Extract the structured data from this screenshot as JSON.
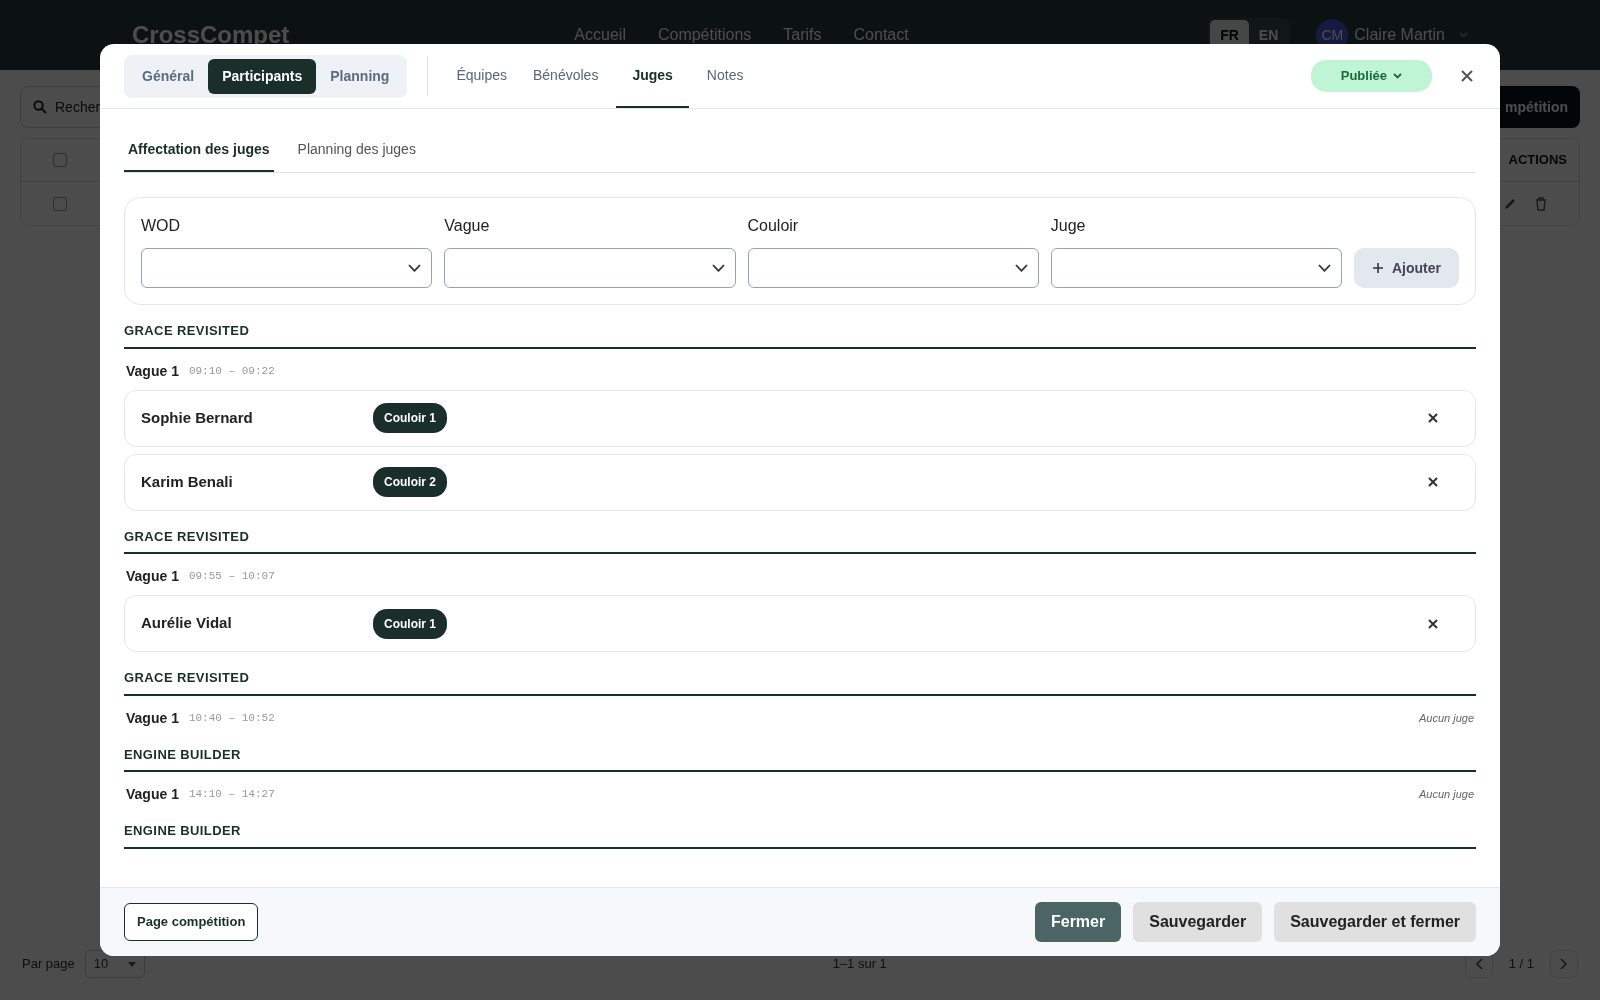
{
  "navbar": {
    "brand": "CrossCompet",
    "links": [
      "Accueil",
      "Compétitions",
      "Tarifs",
      "Contact"
    ],
    "languages": [
      {
        "label": "FR",
        "selected": true
      },
      {
        "label": "EN",
        "selected": false
      }
    ],
    "user": {
      "initials": "CM",
      "name": "Claire Martin"
    }
  },
  "toolbar": {
    "search_placeholder": "Recher",
    "button": "mpétition"
  },
  "table": {
    "header_checked": false,
    "actions_header": "ACTIONS",
    "rows": [
      {
        "checked": false
      }
    ]
  },
  "pagination": {
    "per_page_label": "Par page",
    "per_page": "10",
    "range": "1–1 sur 1",
    "page": "1 / 1"
  },
  "modal": {
    "segments": [
      {
        "label": "Général",
        "selected": false
      },
      {
        "label": "Participants",
        "selected": true
      },
      {
        "label": "Planning",
        "selected": false
      }
    ],
    "tabs": [
      {
        "label": "Équipes",
        "selected": false
      },
      {
        "label": "Bénévoles",
        "selected": false
      },
      {
        "label": "Juges",
        "selected": true
      },
      {
        "label": "Notes",
        "selected": false
      }
    ],
    "status": "Publiée",
    "subtabs": [
      {
        "label": "Affectation des juges",
        "selected": true
      },
      {
        "label": "Planning des juges",
        "selected": false
      }
    ],
    "filters": [
      {
        "label": "WOD"
      },
      {
        "label": "Vague"
      },
      {
        "label": "Couloir"
      },
      {
        "label": "Juge"
      }
    ],
    "add_button": {
      "label": "Ajouter",
      "disabled": true
    },
    "sections": [
      {
        "title": "GRACE REVISITED",
        "waves": [
          {
            "label": "Vague 1",
            "time": "09:10 – 09:22",
            "assignments": [
              {
                "judge": "Sophie Bernard",
                "lane": "Couloir 1"
              },
              {
                "judge": "Karim Benali",
                "lane": "Couloir 2"
              }
            ]
          }
        ]
      },
      {
        "title": "GRACE REVISITED",
        "waves": [
          {
            "label": "Vague 1",
            "time": "09:55 – 10:07",
            "assignments": [
              {
                "judge": "Aurélie Vidal",
                "lane": "Couloir 1"
              }
            ]
          }
        ]
      },
      {
        "title": "GRACE REVISITED",
        "waves": [
          {
            "label": "Vague 1",
            "time": "10:40 – 10:52",
            "empty_text": "Aucun juge"
          }
        ]
      },
      {
        "title": "ENGINE BUILDER",
        "waves": [
          {
            "label": "Vague 1",
            "time": "14:10 – 14:27",
            "empty_text": "Aucun juge"
          }
        ]
      },
      {
        "title": "ENGINE BUILDER"
      }
    ],
    "footer": {
      "left_button": "Page compétition",
      "buttons": [
        {
          "label": "Fermer",
          "kind": "primary"
        },
        {
          "label": "Sauvegarder",
          "kind": "secondary"
        },
        {
          "label": "Sauvegarder et fermer",
          "kind": "secondary"
        }
      ]
    }
  }
}
